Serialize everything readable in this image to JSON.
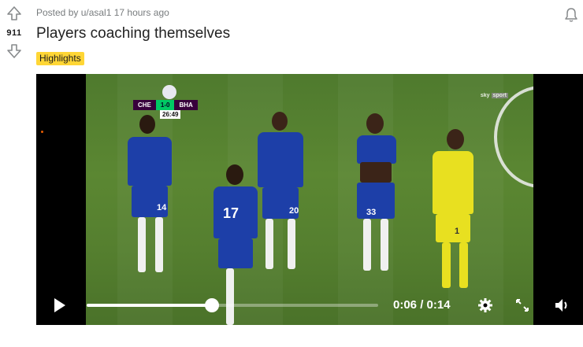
{
  "post": {
    "vote_count": "911",
    "meta": "Posted by u/asal1 17 hours ago",
    "title": "Players coaching themselves",
    "flair": "Highlights"
  },
  "video": {
    "scoreboard": {
      "home": "CHE",
      "score": "1-0",
      "away": "BHA",
      "clock": "26:49"
    },
    "broadcaster": {
      "name": "sky",
      "channel": "sport"
    },
    "players": [
      {
        "number": "14"
      },
      {
        "number": "17"
      },
      {
        "number": "20"
      },
      {
        "number": "33"
      },
      {
        "number": "1"
      }
    ],
    "time_display": "0:06 / 0:14",
    "progress_fraction": 0.43
  },
  "colors": {
    "flair_bg": "#ffd635",
    "chelsea_blue": "#1d3fa8",
    "keeper_yellow": "#e8e020"
  }
}
